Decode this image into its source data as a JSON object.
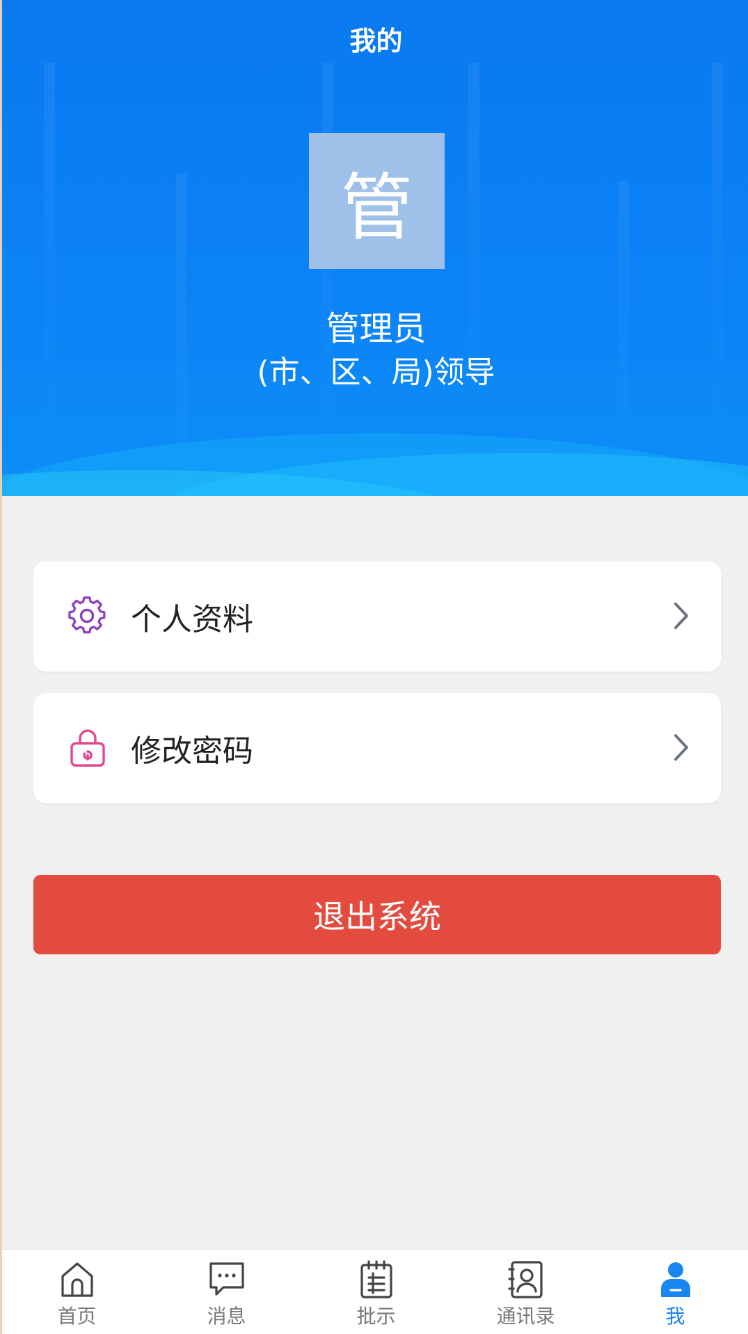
{
  "header": {
    "title": "我的"
  },
  "profile": {
    "avatar_text": "管",
    "name": "管理员",
    "role": "(市、区、局)领导"
  },
  "menu": {
    "items": [
      {
        "label": "个人资料",
        "icon": "gear-icon",
        "icon_color": "#8c3fbf"
      },
      {
        "label": "修改密码",
        "icon": "lock-icon",
        "icon_color": "#e0488f"
      }
    ]
  },
  "logout": {
    "label": "退出系统"
  },
  "tabbar": {
    "items": [
      {
        "label": "首页",
        "icon": "home-icon"
      },
      {
        "label": "消息",
        "icon": "message-icon"
      },
      {
        "label": "批示",
        "icon": "notepad-icon"
      },
      {
        "label": "通讯录",
        "icon": "contacts-icon"
      },
      {
        "label": "我",
        "icon": "user-icon",
        "active": true
      }
    ]
  },
  "colors": {
    "header_blue": "#0b83f6",
    "avatar_bg": "#9fc0e8",
    "logout_red": "#e24b3e",
    "tab_active": "#1a86f2",
    "tab_inactive": "#777777"
  }
}
